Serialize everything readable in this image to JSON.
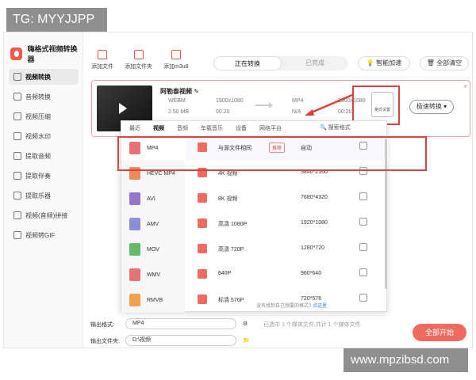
{
  "watermarks": {
    "top": "TG: MYYJJPP",
    "bottom": "www.mpzibsd.com"
  },
  "app": {
    "title": "嗨格式视频转换器",
    "accent": "#f05a4a"
  },
  "sidebar": {
    "items": [
      {
        "label": "视频转换",
        "icon": "video-convert-icon",
        "active": true
      },
      {
        "label": "音频转换",
        "icon": "audio-icon"
      },
      {
        "label": "视频压缩",
        "icon": "compress-icon"
      },
      {
        "label": "视频水印",
        "icon": "watermark-icon"
      },
      {
        "label": "提取音频",
        "icon": "extract-audio-icon"
      },
      {
        "label": "提取伴奏",
        "icon": "accompaniment-icon"
      },
      {
        "label": "提取乐器",
        "icon": "instrument-icon"
      },
      {
        "label": "视频(音频)拼接",
        "icon": "merge-icon"
      },
      {
        "label": "视频转GIF",
        "icon": "gif-icon"
      }
    ]
  },
  "toolbar": {
    "add_file": "添加文件",
    "add_folder": "添加文件夹",
    "add_m3u8": "添加m3u8"
  },
  "tabs": {
    "converting": "正在转换",
    "done": "已完成"
  },
  "header_buttons": {
    "accel": "智能加速",
    "clear": "全部清空"
  },
  "file": {
    "name": "阿勒泰视频",
    "src_format": "WEBM",
    "src_resolution": "1900x1080",
    "src_size": "2.50 MB",
    "src_duration": "00:20",
    "dst_format": "MP4",
    "dst_resolution": "1900x1080",
    "dst_size": "N/A",
    "dst_duration": "00:20",
    "format_setting": "格式设置",
    "fast_convert": "极速转换"
  },
  "popup": {
    "tabs": [
      {
        "label": "最近"
      },
      {
        "label": "视频",
        "active": true
      },
      {
        "label": "音频"
      },
      {
        "label": "车载音乐"
      },
      {
        "label": "设备"
      },
      {
        "label": "网络平台"
      }
    ],
    "search": "搜索格式",
    "formats": [
      {
        "label": "MP4",
        "color": "#e57373",
        "active": true
      },
      {
        "label": "HEVC MP4",
        "color": "#ef8a5a"
      },
      {
        "label": "AVI",
        "color": "#9575cd"
      },
      {
        "label": "AMV",
        "color": "#8c8fd8"
      },
      {
        "label": "MOV",
        "color": "#66bb6a"
      },
      {
        "label": "WMV",
        "color": "#e57373"
      },
      {
        "label": "RMVB",
        "color": "#f0a050"
      }
    ],
    "resolutions": [
      {
        "name": "与源文件相同",
        "tag": "推荐",
        "res": "自动"
      },
      {
        "name": "4K 视频",
        "res": "3840*2160"
      },
      {
        "name": "8K 视频",
        "res": "7680*4320"
      },
      {
        "name": "高清 1080P",
        "res": "1920*1080"
      },
      {
        "name": "高清 720P",
        "res": "1280*720"
      },
      {
        "name": "640P",
        "res": "960*640"
      },
      {
        "name": "标清 576P",
        "res": "720*576"
      }
    ],
    "hint": "没有找到自己想要的格式?",
    "hint_link": "点这里"
  },
  "bottom": {
    "out_format_label": "输出格式:",
    "out_format_value": "MP4",
    "out_folder_label": "输出文件夹:",
    "out_folder_value": "D:\\视频",
    "status": "已选中 1 个媒体文件,共计 1 个媒体文件",
    "start": "全部开始"
  }
}
